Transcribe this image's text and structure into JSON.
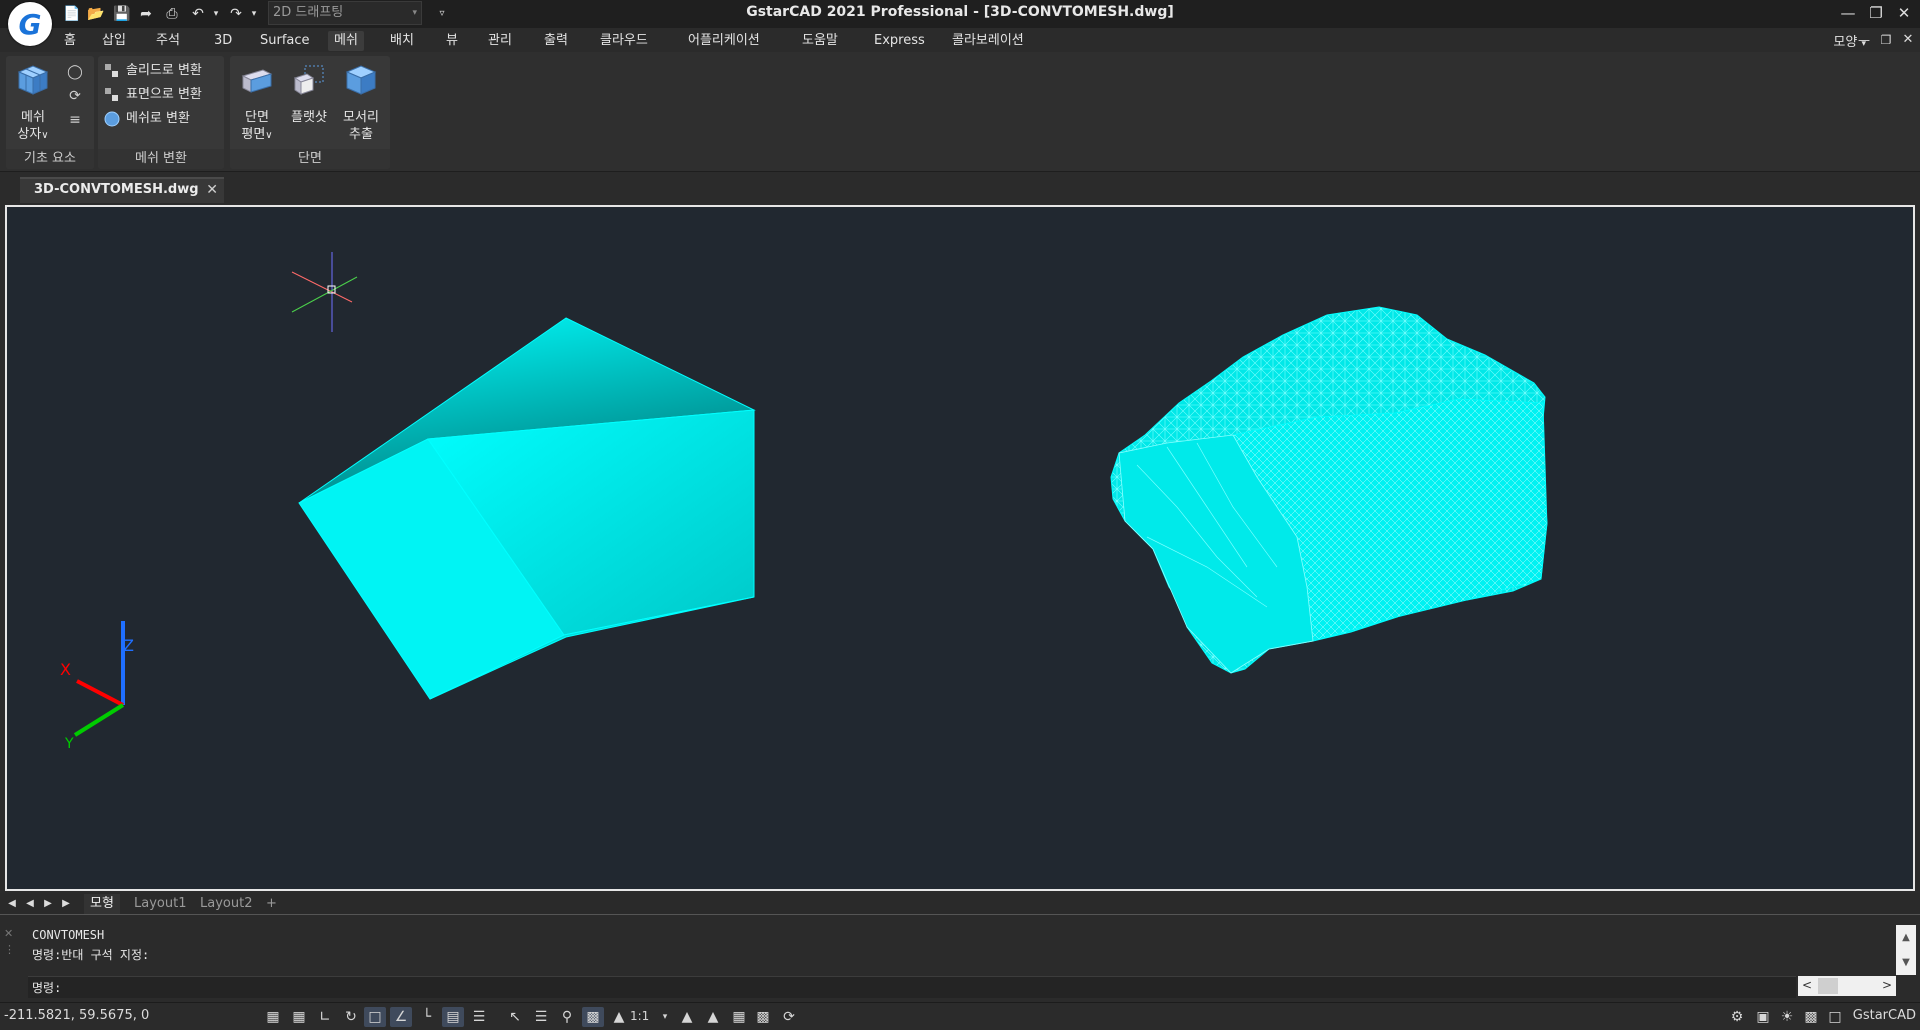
{
  "app": {
    "logo_letter": "G",
    "workspace": "2D 드래프팅",
    "title": "GstarCAD 2021 Professional - [3D-CONVTOMESH.dwg]"
  },
  "menu": {
    "items": [
      "홈",
      "삽입",
      "주석",
      "3D",
      "Surface",
      "메쉬",
      "배치",
      "뷰",
      "관리",
      "출력",
      "클라우드",
      "어플리케이션",
      "도움말",
      "Express",
      "콜라보레이션"
    ],
    "active": "메쉬",
    "ribbon_mode": "모양"
  },
  "ribbon": {
    "panel_basic": {
      "title": "기초 요소",
      "mesh_box_line1": "메쉬",
      "mesh_box_line2": "상자"
    },
    "panel_convert": {
      "title": "메쉬 변환",
      "to_solid": "솔리드로 변환",
      "to_surface": "표면으로 변환",
      "to_mesh": "메쉬로 변환"
    },
    "panel_section": {
      "title": "단면",
      "section_plane_line1": "단면",
      "section_plane_line2": "평면",
      "flatshot": "플랫샷",
      "extract_edges_line1": "모서리",
      "extract_edges_line2": "추출"
    }
  },
  "doc_tab": {
    "name": "3D-CONVTOMESH.dwg"
  },
  "ucs": {
    "z": "Z",
    "x": "X",
    "y": "Y"
  },
  "colors": {
    "viewport_bg": "#212830",
    "solid_light": "#00ffff",
    "solid_dark": "#007f80",
    "ucs_x": "#ff0000",
    "ucs_y": "#00cc00",
    "ucs_z": "#1f6fff"
  },
  "layout_tabs": [
    "모형",
    "Layout1",
    "Layout2",
    "+"
  ],
  "active_layout": "모형",
  "command": {
    "history": [
      "CONVTOMESH",
      "명령:반대 구석 지정:"
    ],
    "prompt": "명령:"
  },
  "status": {
    "coords": "-211.5821, 59.5675, 0",
    "scale": "1:1",
    "brand": "GstarCAD"
  }
}
